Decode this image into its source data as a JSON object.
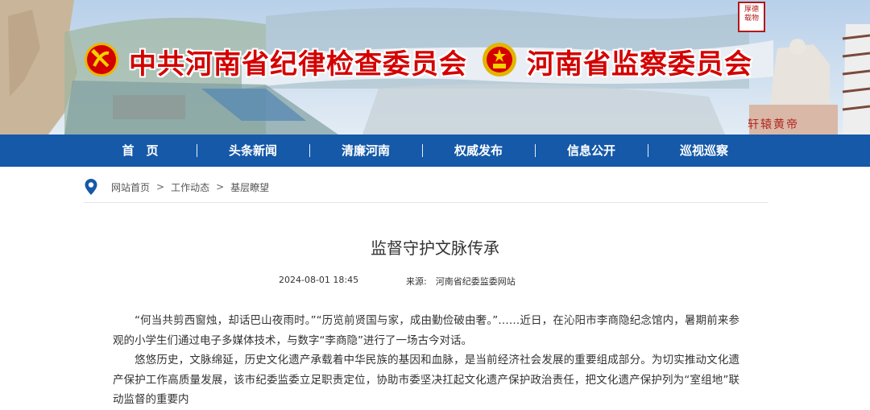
{
  "header": {
    "title_left": "中共河南省纪律检查委员会",
    "title_right": "河南省监察委员会",
    "seal_text": "厚德载物",
    "plaque_text": "轩辕黄帝"
  },
  "nav": {
    "items": [
      "首　页",
      "头条新闻",
      "清廉河南",
      "权威发布",
      "信息公开",
      "巡视巡察"
    ]
  },
  "breadcrumb": {
    "items": [
      "网站首页",
      "工作动态",
      "基层瞭望"
    ],
    "separator": ">"
  },
  "article": {
    "title": "监督守护文脉传承",
    "date": "2024-08-01 18:45",
    "source": "来源:　河南省纪委监委网站",
    "paragraphs": [
      "“何当共剪西窗烛，却话巴山夜雨时。”“历览前贤国与家，成由勤俭破由奢。”……近日，在沁阳市李商隐纪念馆内，暑期前来参观的小学生们通过电子多媒体技术，与数字“李商隐”进行了一场古今对话。",
      "悠悠历史，文脉绵延，历史文化遗产承载着中华民族的基因和血脉，是当前经济社会发展的重要组成部分。为切实推动文化遗产保护工作高质量发展，该市纪委监委立足职责定位，协助市委坚决扛起文化遗产保护政治责任，把文化遗产保护列为“室组地”联动监督的重要内"
    ]
  },
  "colors": {
    "nav_bg": "#1559a8",
    "title_red": "#d40000"
  }
}
